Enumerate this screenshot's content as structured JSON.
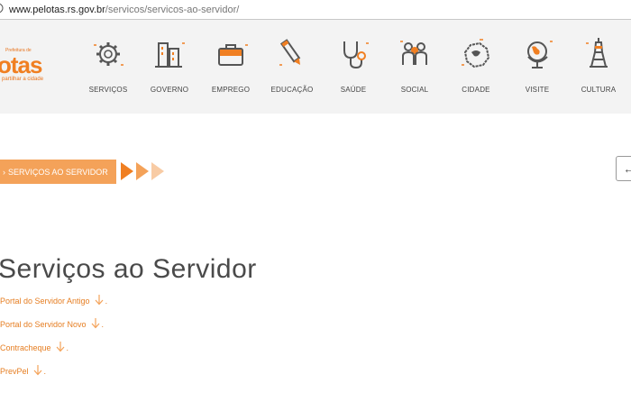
{
  "browser": {
    "url_host": "www.pelotas.rs.gov.br",
    "url_path": "/servicos/servicos-ao-servidor/"
  },
  "logo": {
    "small_text": "Prefeitura de",
    "big_text": "otas",
    "tagline": "partilhar a cidade"
  },
  "nav": {
    "items": [
      {
        "label": "SERVIÇOS",
        "icon": "gear-icon"
      },
      {
        "label": "GOVERNO",
        "icon": "buildings-icon"
      },
      {
        "label": "EMPREGO",
        "icon": "briefcase-icon"
      },
      {
        "label": "EDUCAÇÃO",
        "icon": "pencil-icon"
      },
      {
        "label": "SAÚDE",
        "icon": "stethoscope-icon"
      },
      {
        "label": "SOCIAL",
        "icon": "people-icon"
      },
      {
        "label": "CIDADE",
        "icon": "map-icon"
      },
      {
        "label": "VISITE",
        "icon": "globe-icon"
      },
      {
        "label": "CULTURA",
        "icon": "tower-icon"
      }
    ]
  },
  "breadcrumb": {
    "text": "SERVIÇOS AO SERVIDOR"
  },
  "page": {
    "title": "Serviços ao Servidor"
  },
  "links": [
    {
      "label": "Portal do Servidor Antigo"
    },
    {
      "label": "Portal do Servidor Novo"
    },
    {
      "label": "Contracheque"
    },
    {
      "label": "PrevPel"
    }
  ],
  "colors": {
    "accent": "#f07f22",
    "crumb_bg": "#f4a259",
    "header_bg": "#f3f3f3",
    "link": "#e67e22"
  }
}
